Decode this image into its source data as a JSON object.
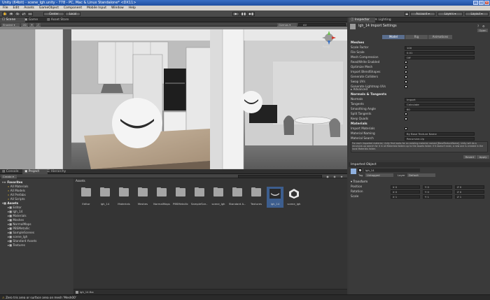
{
  "window": {
    "title": "Unity (64bit) - scene_lgh.unity - 778 - PC, Mac & Linux Standalone* <DX11>"
  },
  "menu": [
    "File",
    "Edit",
    "Assets",
    "GameObject",
    "Component",
    "Mobile Input",
    "Window",
    "Help"
  ],
  "toolbar": {
    "pivot": "Center",
    "space": "Local",
    "account": "Account",
    "layers": "Layers",
    "layout": "Layout"
  },
  "scene": {
    "tabs": [
      "Scene",
      "Game",
      "Asset Store"
    ],
    "shading": "Shaded",
    "mode_2d": "2D",
    "gizmos": "Gizmos",
    "search": "All",
    "persp": "Persp"
  },
  "inspector": {
    "tabs": [
      "Inspector",
      "Lighting"
    ],
    "asset_title": "lgh_14 Import Settings",
    "subtabs": [
      "Model",
      "Rig",
      "Animations"
    ],
    "open_label": "Open",
    "meshes_header": "Meshes",
    "rows": [
      {
        "label": "Scale Factor",
        "value": "100"
      },
      {
        "label": "File Scale",
        "value": "0.01"
      },
      {
        "label": "Mesh Compression",
        "value": "Off"
      },
      {
        "label": "Read/Write Enabled",
        "check": true
      },
      {
        "label": "Optimize Mesh",
        "check": true
      },
      {
        "label": "Import BlendShapes",
        "check": true
      },
      {
        "label": "Generate Colliders",
        "check": false
      },
      {
        "label": "Swap UVs",
        "check": false
      },
      {
        "label": "Generate Lightmap UVs",
        "check": false
      }
    ],
    "advanced": "Advanced",
    "normals_header": "Normals & Tangents",
    "normals_rows": [
      {
        "label": "Normals",
        "value": "Import"
      },
      {
        "label": "Tangents",
        "value": "Calculate"
      },
      {
        "label": "Smoothing Angle",
        "value": "60"
      },
      {
        "label": "Split Tangents",
        "check": true
      },
      {
        "label": "Keep Quads",
        "check": false
      }
    ],
    "materials_header": "Materials",
    "materials_rows": [
      {
        "label": "Import Materials",
        "check": true
      },
      {
        "label": "Material Naming",
        "value": "By Base Texture Name"
      },
      {
        "label": "Material Search",
        "value": "Recursive-Up"
      }
    ],
    "help_text": "For each imported material, Unity first looks for an existing material named [BaseTextureName]. Unity will do a recursive-up search for it in all Materials folders up to the Assets folder. If it doesn't exist, a new one is created in the local Materials folder.",
    "revert": "Revert",
    "apply": "Apply",
    "imported_object_header": "Imported Object",
    "object_name": "lgh_14",
    "tag_label": "Tag",
    "tag_value": "Untagged",
    "layer_label": "Layer",
    "layer_value": "Default",
    "transform_header": "Transform",
    "transform_rows": [
      {
        "label": "Position",
        "x": "X 0",
        "y": "Y 0",
        "z": "Z 0"
      },
      {
        "label": "Rotation",
        "x": "X 0",
        "y": "Y 0",
        "z": "Z 0"
      },
      {
        "label": "Scale",
        "x": "X 1",
        "y": "Y 1",
        "z": "Z 1"
      }
    ]
  },
  "bottom": {
    "tabs": [
      "Console",
      "Project",
      "Hierarchy"
    ],
    "create": "Create",
    "breadcrumb": "Assets"
  },
  "project_tree": [
    {
      "label": "Favorites",
      "level": 0,
      "bold": true
    },
    {
      "label": "All Materials",
      "level": 1
    },
    {
      "label": "All Models",
      "level": 1
    },
    {
      "label": "All Prefabs",
      "level": 1
    },
    {
      "label": "All Scripts",
      "level": 1
    },
    {
      "label": "Assets",
      "level": 0,
      "bold": true
    },
    {
      "label": "Editor",
      "level": 1
    },
    {
      "label": "lgh_14",
      "level": 1
    },
    {
      "label": "Materials",
      "level": 1
    },
    {
      "label": "Meshes",
      "level": 1
    },
    {
      "label": "NormalMaps",
      "level": 1
    },
    {
      "label": "PBSMetallic",
      "level": 1
    },
    {
      "label": "SampleScenes",
      "level": 1
    },
    {
      "label": "scene_lgh",
      "level": 1
    },
    {
      "label": "Standard Assets",
      "level": 1
    },
    {
      "label": "Textures",
      "level": 1
    }
  ],
  "assets": [
    {
      "label": "Editor",
      "type": "folder"
    },
    {
      "label": "lgh_14",
      "type": "folder"
    },
    {
      "label": "Materials",
      "type": "folder"
    },
    {
      "label": "Meshes",
      "type": "folder"
    },
    {
      "label": "NormalMaps",
      "type": "folder"
    },
    {
      "label": "PBSMetallic",
      "type": "folder"
    },
    {
      "label": "SampleSce...",
      "type": "folder"
    },
    {
      "label": "scene_lgh",
      "type": "folder"
    },
    {
      "label": "Standard A...",
      "type": "folder"
    },
    {
      "label": "Textures",
      "type": "folder"
    },
    {
      "label": "lgh_14",
      "type": "model",
      "selected": true
    },
    {
      "label": "scene_lgh",
      "type": "unity"
    }
  ],
  "project_footer": "lgh_14.fbx",
  "status": "Zero tris area or surface area on mesh 'Mesh00'",
  "colors": {
    "accent": "#3a72c4",
    "selection": "#3d5e8e",
    "panel": "#3a3a3a"
  }
}
